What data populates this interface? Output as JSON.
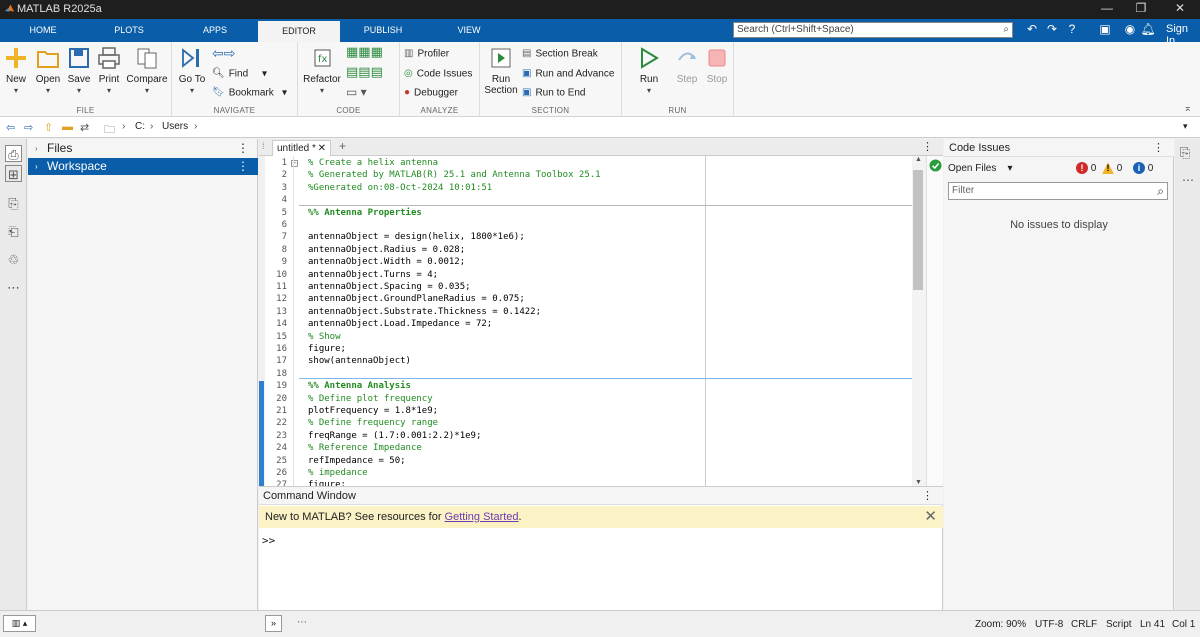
{
  "window": {
    "title": "MATLAB R2025a"
  },
  "tabs": [
    {
      "label": "HOME",
      "active": false
    },
    {
      "label": "PLOTS",
      "active": false
    },
    {
      "label": "APPS",
      "active": false
    },
    {
      "label": "EDITOR",
      "active": true
    },
    {
      "label": "PUBLISH",
      "active": false
    },
    {
      "label": "VIEW",
      "active": false
    }
  ],
  "search": {
    "placeholder": "Search (Ctrl+Shift+Space)"
  },
  "signin": "Sign In",
  "toolstrip": {
    "file": {
      "label": "FILE",
      "new": "New",
      "open": "Open",
      "save": "Save",
      "print": "Print",
      "compare": "Compare"
    },
    "navigate": {
      "label": "NAVIGATE",
      "goto": "Go To",
      "find": "Find",
      "bookmark": "Bookmark"
    },
    "code": {
      "label": "CODE",
      "refactor": "Refactor"
    },
    "analyze": {
      "label": "ANALYZE",
      "profiler": "Profiler",
      "code_issues": "Code Issues",
      "debugger": "Debugger"
    },
    "section": {
      "label": "SECTION",
      "run_section_1": "Run",
      "run_section_2": "Section",
      "section_break": "Section Break",
      "run_and_advance": "Run and Advance",
      "run_to_end": "Run to End"
    },
    "run": {
      "label": "RUN",
      "run": "Run",
      "step": "Step",
      "stop": "Stop"
    }
  },
  "address": {
    "drive": "C:",
    "folder": "Users"
  },
  "left_panel": {
    "files": "Files",
    "workspace": "Workspace"
  },
  "editor": {
    "tab_label": "untitled *",
    "lines": [
      {
        "n": "1",
        "t": "% Create a helix antenna",
        "k": "cmt"
      },
      {
        "n": "2",
        "t": "% Generated by MATLAB(R) 25.1 and Antenna Toolbox 25.1",
        "k": "cmt"
      },
      {
        "n": "3",
        "t": "%Generated on:08-Oct-2024 10:01:51",
        "k": "cmt"
      },
      {
        "n": "4",
        "t": "",
        "k": "code"
      },
      {
        "n": "5",
        "t": "%% Antenna Properties",
        "k": "sec"
      },
      {
        "n": "6",
        "t": "",
        "k": "code"
      },
      {
        "n": "7",
        "t": "antennaObject = design(helix, 1800*1e6);",
        "k": "code"
      },
      {
        "n": "8",
        "t": "antennaObject.Radius = 0.028;",
        "k": "code"
      },
      {
        "n": "9",
        "t": "antennaObject.Width = 0.0012;",
        "k": "code"
      },
      {
        "n": "10",
        "t": "antennaObject.Turns = 4;",
        "k": "code"
      },
      {
        "n": "11",
        "t": "antennaObject.Spacing = 0.035;",
        "k": "code"
      },
      {
        "n": "12",
        "t": "antennaObject.GroundPlaneRadius = 0.075;",
        "k": "code"
      },
      {
        "n": "13",
        "t": "antennaObject.Substrate.Thickness = 0.1422;",
        "k": "code"
      },
      {
        "n": "14",
        "t": "antennaObject.Load.Impedance = 72;",
        "k": "code"
      },
      {
        "n": "15",
        "t": "% Show",
        "k": "cmt"
      },
      {
        "n": "16",
        "t": "figure;",
        "k": "code"
      },
      {
        "n": "17",
        "t": "show(antennaObject)",
        "k": "code"
      },
      {
        "n": "18",
        "t": "",
        "k": "code"
      },
      {
        "n": "19",
        "t": "%% Antenna Analysis",
        "k": "sec"
      },
      {
        "n": "20",
        "t": "% Define plot frequency",
        "k": "cmt"
      },
      {
        "n": "21",
        "t": "plotFrequency = 1.8*1e9;",
        "k": "code"
      },
      {
        "n": "22",
        "t": "% Define frequency range",
        "k": "cmt"
      },
      {
        "n": "23",
        "t": "freqRange = (1.7:0.001:2.2)*1e9;",
        "k": "code"
      },
      {
        "n": "24",
        "t": "% Reference Impedance",
        "k": "cmt"
      },
      {
        "n": "25",
        "t": "refImpedance = 50;",
        "k": "code"
      },
      {
        "n": "26",
        "t": "% impedance",
        "k": "cmt"
      },
      {
        "n": "27",
        "t": "figure;",
        "k": "code"
      }
    ]
  },
  "command_window": {
    "title": "Command Window",
    "banner_text": "New to MATLAB? See resources for ",
    "banner_link": "Getting Started",
    "banner_end": ".",
    "prompt": ">>"
  },
  "code_issues": {
    "title": "Code Issues",
    "scope": "Open Files",
    "errors": "0",
    "warnings": "0",
    "infos": "0",
    "filter_placeholder": "Filter",
    "empty_message": "No issues to display"
  },
  "status": {
    "zoom": "Zoom: 90%",
    "encoding": "UTF-8",
    "eol": "CRLF",
    "type": "Script",
    "line": "Ln  41",
    "col": "Col  1"
  },
  "colors": {
    "accent": "#0a5da8",
    "comment": "#228B22",
    "banner": "#fbf2c6"
  }
}
